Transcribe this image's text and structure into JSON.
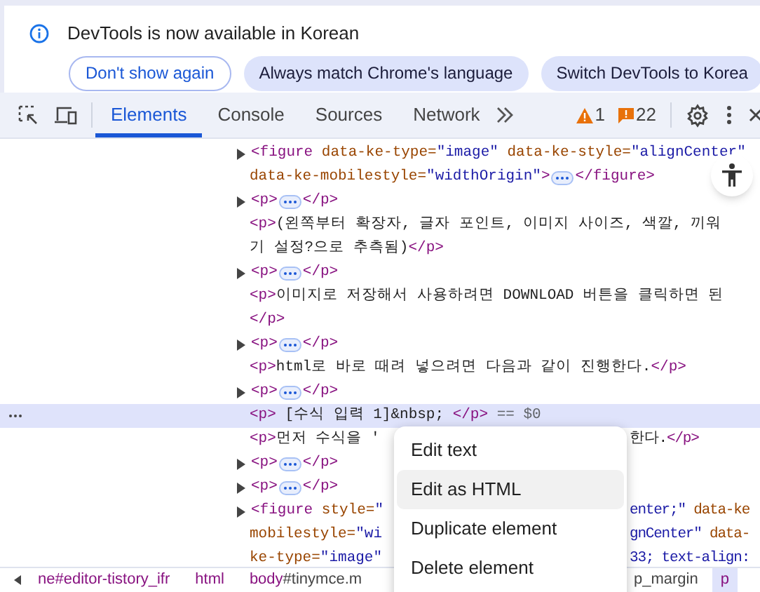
{
  "infobar": {
    "message": "DevTools is now available in Korean",
    "buttons": [
      {
        "label": "Don't show again",
        "kind": "outline"
      },
      {
        "label": "Always match Chrome's language",
        "kind": "filled"
      },
      {
        "label": "Switch DevTools to Korea",
        "kind": "filled"
      }
    ]
  },
  "toolbar": {
    "tabs": [
      {
        "label": "Elements",
        "selected": true
      },
      {
        "label": "Console",
        "selected": false
      },
      {
        "label": "Sources",
        "selected": false
      },
      {
        "label": "Network",
        "selected": false
      }
    ],
    "warnings": "1",
    "messages": "22"
  },
  "dom_lines": [
    {
      "expandable": true,
      "selected": false,
      "segments": [
        {
          "kind": "tag",
          "text": "<figure"
        },
        {
          "kind": "attr",
          "text": " data-ke-type="
        },
        {
          "kind": "value",
          "text": "\"image\""
        },
        {
          "kind": "attr",
          "text": " data-ke-style="
        },
        {
          "kind": "value",
          "text": "\"alignCenter\""
        }
      ]
    },
    {
      "expandable": false,
      "selected": false,
      "segments": [
        {
          "kind": "attr",
          "text": "data-ke-mobilestyle="
        },
        {
          "kind": "value",
          "text": "\"widthOrigin\""
        },
        {
          "kind": "tag",
          "text": ">"
        },
        {
          "kind": "ellipsis"
        },
        {
          "kind": "tag",
          "text": "</figure>"
        }
      ]
    },
    {
      "expandable": true,
      "selected": false,
      "segments": [
        {
          "kind": "tag",
          "text": "<p>"
        },
        {
          "kind": "ellipsis"
        },
        {
          "kind": "tag",
          "text": "</p>"
        }
      ]
    },
    {
      "expandable": false,
      "selected": false,
      "segments": [
        {
          "kind": "tag",
          "text": "<p>"
        },
        {
          "kind": "text",
          "text": "(왼쪽부터 확장자, 글자 포인트, 이미지 사이즈, 색깔, 끼워"
        }
      ]
    },
    {
      "expandable": false,
      "selected": false,
      "segments": [
        {
          "kind": "text",
          "text": "기 설정?으로 추측됨)"
        },
        {
          "kind": "tag",
          "text": "</p>"
        }
      ]
    },
    {
      "expandable": true,
      "selected": false,
      "segments": [
        {
          "kind": "tag",
          "text": "<p>"
        },
        {
          "kind": "ellipsis"
        },
        {
          "kind": "tag",
          "text": "</p>"
        }
      ]
    },
    {
      "expandable": false,
      "selected": false,
      "segments": [
        {
          "kind": "tag",
          "text": "<p>"
        },
        {
          "kind": "text",
          "text": "이미지로 저장해서 사용하려면 DOWNLOAD 버튼을 클릭하면 된"
        }
      ]
    },
    {
      "expandable": false,
      "selected": false,
      "segments": [
        {
          "kind": "tag",
          "text": "</p>"
        }
      ]
    },
    {
      "expandable": true,
      "selected": false,
      "segments": [
        {
          "kind": "tag",
          "text": "<p>"
        },
        {
          "kind": "ellipsis"
        },
        {
          "kind": "tag",
          "text": "</p>"
        }
      ]
    },
    {
      "expandable": false,
      "selected": false,
      "segments": [
        {
          "kind": "tag",
          "text": "<p>"
        },
        {
          "kind": "text",
          "text": "html로 바로 때려 넣으려면 다음과 같이 진행한다."
        },
        {
          "kind": "tag",
          "text": "</p>"
        }
      ]
    },
    {
      "expandable": true,
      "selected": false,
      "segments": [
        {
          "kind": "tag",
          "text": "<p>"
        },
        {
          "kind": "ellipsis"
        },
        {
          "kind": "tag",
          "text": "</p>"
        }
      ]
    },
    {
      "expandable": false,
      "selected": true,
      "segments": [
        {
          "kind": "tag",
          "text": "<p>"
        },
        {
          "kind": "text",
          "text": " [수식 입력 1]&nbsp; "
        },
        {
          "kind": "tag",
          "text": "</p>"
        },
        {
          "kind": "note",
          "text": " == $0"
        }
      ]
    },
    {
      "expandable": false,
      "selected": false,
      "segments": [
        {
          "kind": "tag",
          "text": "<p>"
        },
        {
          "kind": "text",
          "text": "먼저 수식을 '"
        }
      ],
      "right": [
        {
          "kind": "text",
          "text": "한다."
        },
        {
          "kind": "tag",
          "text": "</p>"
        }
      ]
    },
    {
      "expandable": true,
      "selected": false,
      "segments": [
        {
          "kind": "tag",
          "text": "<p>"
        },
        {
          "kind": "ellipsis"
        },
        {
          "kind": "tag",
          "text": "</p>"
        }
      ]
    },
    {
      "expandable": true,
      "selected": false,
      "segments": [
        {
          "kind": "tag",
          "text": "<p>"
        },
        {
          "kind": "ellipsis"
        },
        {
          "kind": "tag",
          "text": "</p>"
        }
      ]
    },
    {
      "expandable": true,
      "selected": false,
      "segments": [
        {
          "kind": "tag",
          "text": "<figure"
        },
        {
          "kind": "attr",
          "text": " style="
        },
        {
          "kind": "value",
          "text": "\""
        }
      ],
      "right": [
        {
          "kind": "value",
          "text": "enter;\""
        },
        {
          "kind": "attr",
          "text": " data-ke"
        }
      ]
    },
    {
      "expandable": false,
      "selected": false,
      "segments": [
        {
          "kind": "attr",
          "text": "mobilestyle="
        },
        {
          "kind": "value",
          "text": "\"wi"
        }
      ],
      "right": [
        {
          "kind": "value",
          "text": "gnCenter\""
        },
        {
          "kind": "attr",
          "text": " data-"
        }
      ]
    },
    {
      "expandable": false,
      "selected": false,
      "segments": [
        {
          "kind": "attr",
          "text": "ke-type="
        },
        {
          "kind": "value",
          "text": "\"image\""
        }
      ],
      "right": [
        {
          "kind": "value",
          "text": "33; text-align:"
        }
      ]
    }
  ],
  "breadcrumbs": {
    "left": [
      {
        "rest": "ne#editor-tistory_ifr",
        "selected": false
      },
      {
        "tag": "html",
        "selected": false
      },
      {
        "tag": "body",
        "rest": "#tinymce.m",
        "selected": false
      }
    ],
    "right": [
      {
        "rest": "p_margin",
        "selected": false
      },
      {
        "tag": "p",
        "selected": true
      }
    ]
  },
  "context_menu": {
    "items": [
      {
        "label": "Edit text",
        "selected": false
      },
      {
        "label": "Edit as HTML",
        "selected": true
      },
      {
        "label": "Duplicate element",
        "selected": false
      },
      {
        "label": "Delete element",
        "selected": false
      }
    ]
  }
}
